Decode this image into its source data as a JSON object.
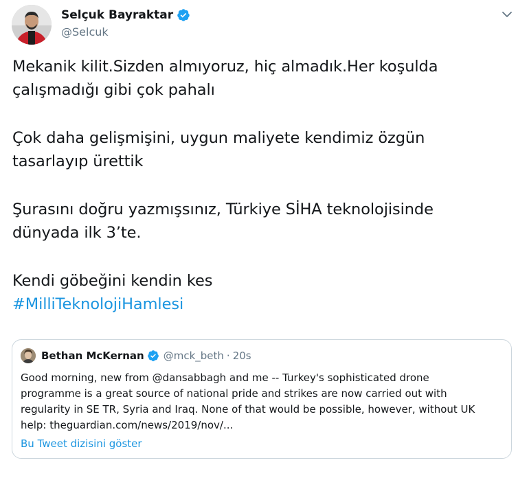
{
  "author": {
    "name": "Selçuk Bayraktar",
    "handle": "@Selcuk",
    "verified": true
  },
  "tweet": {
    "lines": [
      "Mekanik kilit.Sizden almıyoruz, hiç almadık.Her koşulda",
      "çalışmadığı gibi çok pahalı",
      "Çok daha gelişmişini, uygun maliyete kendimiz özgün",
      "tasarlayıp ürettik",
      "Şurasını doğru yazmışsınız, Türkiye SİHA teknolojisinde",
      "dünyada ilk 3’te.",
      "Kendi göbeğini kendin kes"
    ],
    "hashtag": "#MilliTeknolojiHamlesi"
  },
  "quoted_tweet": {
    "author_name": "Bethan McKernan",
    "handle": "@mck_beth",
    "separator": "·",
    "time": "20s",
    "verified": true,
    "lines": [
      "Good morning, new from @dansabbagh and me -- Turkey's sophisticated drone",
      "programme is a great source of national pride and strikes are now carried out with",
      "regularity in SE TR, Syria and Iraq. None of that would be possible, however, without UK",
      "help: theguardian.com/news/2019/nov/..."
    ],
    "thread_link": "Bu Tweet dizisini göster"
  },
  "colors": {
    "text": "#14171a",
    "secondary": "#657786",
    "link": "#1b95e0",
    "border": "#ccd6dd",
    "verified_badge": "#1da1f2"
  },
  "icons": {
    "caret": "chevron-down-icon",
    "verified": "verified-badge-icon"
  }
}
